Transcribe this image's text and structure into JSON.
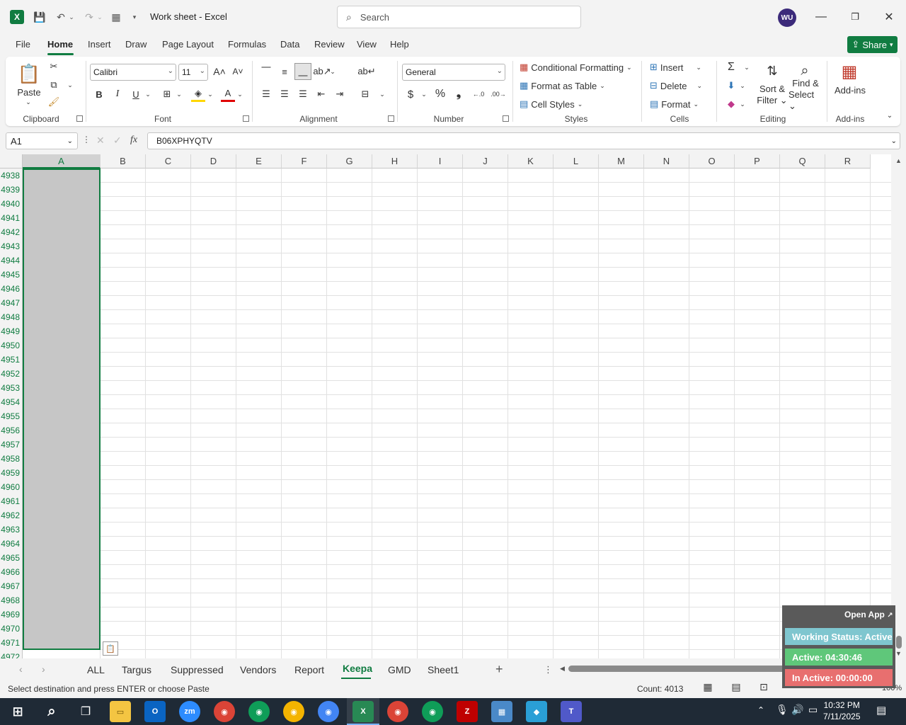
{
  "titlebar": {
    "doc_title": "Work sheet  -  Excel",
    "search_placeholder": "Search",
    "avatar_initials": "WU"
  },
  "ribbon_tabs": [
    "File",
    "Home",
    "Insert",
    "Draw",
    "Page Layout",
    "Formulas",
    "Data",
    "Review",
    "View",
    "Help"
  ],
  "share_label": "Share",
  "ribbon": {
    "clipboard": {
      "paste": "Paste",
      "label": "Clipboard"
    },
    "font": {
      "name": "Calibri",
      "size": "11",
      "label": "Font",
      "bold": "B",
      "italic": "I",
      "underline": "U"
    },
    "alignment": {
      "label": "Alignment"
    },
    "number": {
      "format": "General",
      "label": "Number",
      "currency": "$",
      "percent": "%"
    },
    "styles": {
      "conditional": "Conditional Formatting",
      "format_table": "Format as Table",
      "cell_styles": "Cell Styles",
      "label": "Styles"
    },
    "cells": {
      "insert": "Insert",
      "delete": "Delete",
      "format": "Format",
      "label": "Cells"
    },
    "editing": {
      "sort_filter_1": "Sort &",
      "sort_filter_2": "Filter",
      "find_select_1": "Find &",
      "find_select_2": "Select",
      "label": "Editing"
    },
    "addins": {
      "button": "Add-ins",
      "label": "Add-ins"
    }
  },
  "formula_bar": {
    "name_box": "A1",
    "fx": "fx",
    "value": "B06XPHYQTV"
  },
  "columns": [
    "A",
    "B",
    "C",
    "D",
    "E",
    "F",
    "G",
    "H",
    "I",
    "J",
    "K",
    "L",
    "M",
    "N",
    "O",
    "P",
    "Q",
    "R"
  ],
  "rows": [
    "4938",
    "4939",
    "4940",
    "4941",
    "4942",
    "4943",
    "4944",
    "4945",
    "4946",
    "4947",
    "4948",
    "4949",
    "4950",
    "4951",
    "4952",
    "4953",
    "4954",
    "4955",
    "4956",
    "4957",
    "4958",
    "4959",
    "4960",
    "4961",
    "4962",
    "4963",
    "4964",
    "4965",
    "4966",
    "4967",
    "4968",
    "4969",
    "4970",
    "4971",
    "4972"
  ],
  "sheets": [
    "ALL",
    "Targus",
    "Suppressed",
    "Vendors",
    "Report",
    "Keepa",
    "GMD",
    "Sheet1"
  ],
  "active_sheet": "Keepa",
  "status": {
    "message": "Select destination and press ENTER or choose Paste",
    "count": "Count: 4013",
    "zoom": "100%"
  },
  "widget": {
    "open_app": "Open App",
    "working_status": "Working Status: Active",
    "active": "Active: 04:30:46",
    "inactive": "In Active: 00:00:00"
  },
  "taskbar": {
    "time": "10:32 PM",
    "date": "7/11/2025"
  },
  "colors": {
    "excel_green": "#107c41",
    "widget_active": "#5fc77a",
    "widget_status": "#7fc6cf",
    "widget_inactive": "#e86f6f"
  }
}
